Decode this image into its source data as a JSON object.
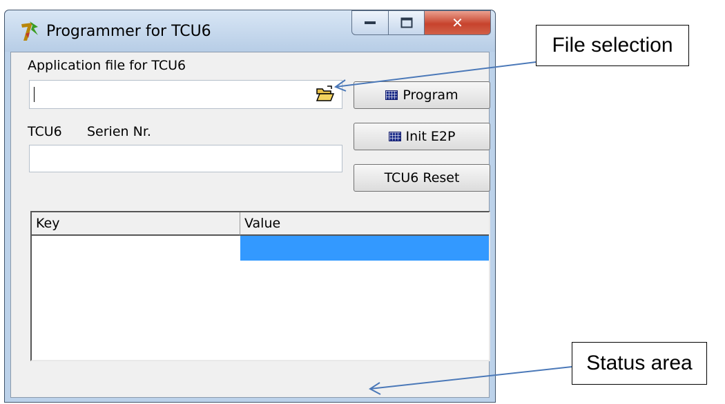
{
  "window": {
    "title": "Programmer for TCU6",
    "icon": "tcu-app-icon"
  },
  "form": {
    "app_file_label": "Application file for TCU6",
    "app_file_value": "",
    "tcu_label": "TCU6",
    "serial_label": "Serien Nr.",
    "serial_value": ""
  },
  "buttons": {
    "program": "Program",
    "init_e2p": "Init E2P",
    "reset": "TCU6 Reset"
  },
  "table": {
    "columns": [
      "Key",
      "Value"
    ],
    "rows": [
      {
        "key": "",
        "value": ""
      }
    ],
    "selected_color": "#3399ff"
  },
  "annotations": {
    "file_selection": "File selection",
    "status_area": "Status area"
  },
  "colors": {
    "frame": "#bcd2ea",
    "close": "#c7432d"
  }
}
